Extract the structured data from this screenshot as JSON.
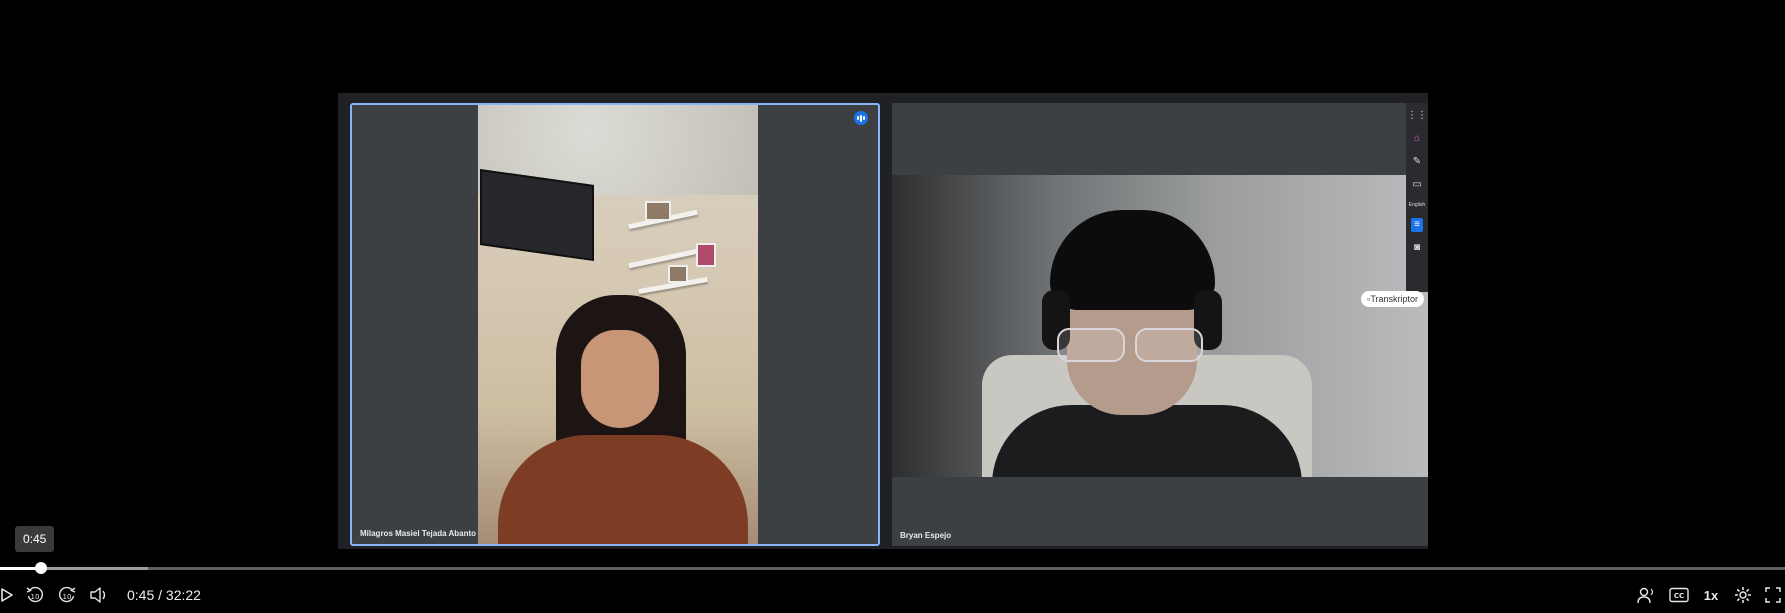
{
  "participants": [
    {
      "name": "Milagros Masiel Tejada Abanto",
      "speaking": true
    },
    {
      "name": "Bryan Espejo",
      "speaking": false
    }
  ],
  "overlay": {
    "transkriptor_label": "Transkriptor",
    "toolbar_language_label": "English"
  },
  "player": {
    "hover_time": "0:45",
    "time_display": "0:45 / 32:22",
    "current_time": "0:45",
    "duration": "32:22",
    "played_fraction": 0.0232,
    "buffered_fraction": 0.083,
    "speed_label": "1x",
    "accent_color": "#ffffff"
  },
  "icons": {
    "play": "play-icon",
    "rewind": "rewind-10-icon",
    "forward": "forward-10-icon",
    "volume": "volume-icon",
    "audio_description": "audio-description-icon",
    "captions": "captions-icon",
    "settings": "gear-icon",
    "fullscreen": "fullscreen-icon"
  }
}
